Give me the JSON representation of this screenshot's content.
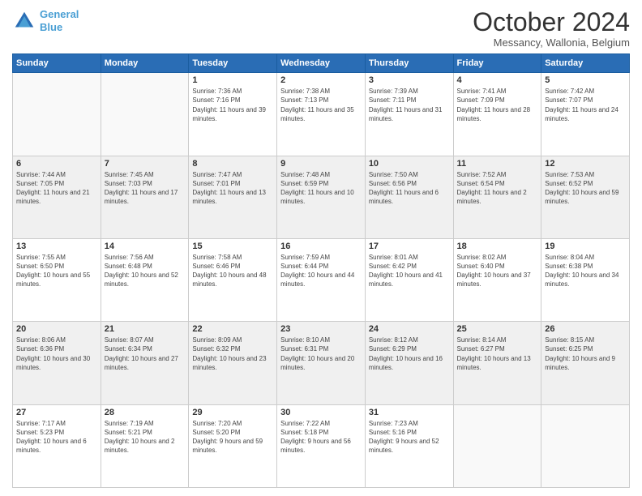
{
  "header": {
    "logo_line1": "General",
    "logo_line2": "Blue",
    "month": "October 2024",
    "location": "Messancy, Wallonia, Belgium"
  },
  "weekdays": [
    "Sunday",
    "Monday",
    "Tuesday",
    "Wednesday",
    "Thursday",
    "Friday",
    "Saturday"
  ],
  "weeks": [
    [
      {
        "day": "",
        "sunrise": "",
        "sunset": "",
        "daylight": ""
      },
      {
        "day": "",
        "sunrise": "",
        "sunset": "",
        "daylight": ""
      },
      {
        "day": "1",
        "sunrise": "Sunrise: 7:36 AM",
        "sunset": "Sunset: 7:16 PM",
        "daylight": "Daylight: 11 hours and 39 minutes."
      },
      {
        "day": "2",
        "sunrise": "Sunrise: 7:38 AM",
        "sunset": "Sunset: 7:13 PM",
        "daylight": "Daylight: 11 hours and 35 minutes."
      },
      {
        "day": "3",
        "sunrise": "Sunrise: 7:39 AM",
        "sunset": "Sunset: 7:11 PM",
        "daylight": "Daylight: 11 hours and 31 minutes."
      },
      {
        "day": "4",
        "sunrise": "Sunrise: 7:41 AM",
        "sunset": "Sunset: 7:09 PM",
        "daylight": "Daylight: 11 hours and 28 minutes."
      },
      {
        "day": "5",
        "sunrise": "Sunrise: 7:42 AM",
        "sunset": "Sunset: 7:07 PM",
        "daylight": "Daylight: 11 hours and 24 minutes."
      }
    ],
    [
      {
        "day": "6",
        "sunrise": "Sunrise: 7:44 AM",
        "sunset": "Sunset: 7:05 PM",
        "daylight": "Daylight: 11 hours and 21 minutes."
      },
      {
        "day": "7",
        "sunrise": "Sunrise: 7:45 AM",
        "sunset": "Sunset: 7:03 PM",
        "daylight": "Daylight: 11 hours and 17 minutes."
      },
      {
        "day": "8",
        "sunrise": "Sunrise: 7:47 AM",
        "sunset": "Sunset: 7:01 PM",
        "daylight": "Daylight: 11 hours and 13 minutes."
      },
      {
        "day": "9",
        "sunrise": "Sunrise: 7:48 AM",
        "sunset": "Sunset: 6:59 PM",
        "daylight": "Daylight: 11 hours and 10 minutes."
      },
      {
        "day": "10",
        "sunrise": "Sunrise: 7:50 AM",
        "sunset": "Sunset: 6:56 PM",
        "daylight": "Daylight: 11 hours and 6 minutes."
      },
      {
        "day": "11",
        "sunrise": "Sunrise: 7:52 AM",
        "sunset": "Sunset: 6:54 PM",
        "daylight": "Daylight: 11 hours and 2 minutes."
      },
      {
        "day": "12",
        "sunrise": "Sunrise: 7:53 AM",
        "sunset": "Sunset: 6:52 PM",
        "daylight": "Daylight: 10 hours and 59 minutes."
      }
    ],
    [
      {
        "day": "13",
        "sunrise": "Sunrise: 7:55 AM",
        "sunset": "Sunset: 6:50 PM",
        "daylight": "Daylight: 10 hours and 55 minutes."
      },
      {
        "day": "14",
        "sunrise": "Sunrise: 7:56 AM",
        "sunset": "Sunset: 6:48 PM",
        "daylight": "Daylight: 10 hours and 52 minutes."
      },
      {
        "day": "15",
        "sunrise": "Sunrise: 7:58 AM",
        "sunset": "Sunset: 6:46 PM",
        "daylight": "Daylight: 10 hours and 48 minutes."
      },
      {
        "day": "16",
        "sunrise": "Sunrise: 7:59 AM",
        "sunset": "Sunset: 6:44 PM",
        "daylight": "Daylight: 10 hours and 44 minutes."
      },
      {
        "day": "17",
        "sunrise": "Sunrise: 8:01 AM",
        "sunset": "Sunset: 6:42 PM",
        "daylight": "Daylight: 10 hours and 41 minutes."
      },
      {
        "day": "18",
        "sunrise": "Sunrise: 8:02 AM",
        "sunset": "Sunset: 6:40 PM",
        "daylight": "Daylight: 10 hours and 37 minutes."
      },
      {
        "day": "19",
        "sunrise": "Sunrise: 8:04 AM",
        "sunset": "Sunset: 6:38 PM",
        "daylight": "Daylight: 10 hours and 34 minutes."
      }
    ],
    [
      {
        "day": "20",
        "sunrise": "Sunrise: 8:06 AM",
        "sunset": "Sunset: 6:36 PM",
        "daylight": "Daylight: 10 hours and 30 minutes."
      },
      {
        "day": "21",
        "sunrise": "Sunrise: 8:07 AM",
        "sunset": "Sunset: 6:34 PM",
        "daylight": "Daylight: 10 hours and 27 minutes."
      },
      {
        "day": "22",
        "sunrise": "Sunrise: 8:09 AM",
        "sunset": "Sunset: 6:32 PM",
        "daylight": "Daylight: 10 hours and 23 minutes."
      },
      {
        "day": "23",
        "sunrise": "Sunrise: 8:10 AM",
        "sunset": "Sunset: 6:31 PM",
        "daylight": "Daylight: 10 hours and 20 minutes."
      },
      {
        "day": "24",
        "sunrise": "Sunrise: 8:12 AM",
        "sunset": "Sunset: 6:29 PM",
        "daylight": "Daylight: 10 hours and 16 minutes."
      },
      {
        "day": "25",
        "sunrise": "Sunrise: 8:14 AM",
        "sunset": "Sunset: 6:27 PM",
        "daylight": "Daylight: 10 hours and 13 minutes."
      },
      {
        "day": "26",
        "sunrise": "Sunrise: 8:15 AM",
        "sunset": "Sunset: 6:25 PM",
        "daylight": "Daylight: 10 hours and 9 minutes."
      }
    ],
    [
      {
        "day": "27",
        "sunrise": "Sunrise: 7:17 AM",
        "sunset": "Sunset: 5:23 PM",
        "daylight": "Daylight: 10 hours and 6 minutes."
      },
      {
        "day": "28",
        "sunrise": "Sunrise: 7:19 AM",
        "sunset": "Sunset: 5:21 PM",
        "daylight": "Daylight: 10 hours and 2 minutes."
      },
      {
        "day": "29",
        "sunrise": "Sunrise: 7:20 AM",
        "sunset": "Sunset: 5:20 PM",
        "daylight": "Daylight: 9 hours and 59 minutes."
      },
      {
        "day": "30",
        "sunrise": "Sunrise: 7:22 AM",
        "sunset": "Sunset: 5:18 PM",
        "daylight": "Daylight: 9 hours and 56 minutes."
      },
      {
        "day": "31",
        "sunrise": "Sunrise: 7:23 AM",
        "sunset": "Sunset: 5:16 PM",
        "daylight": "Daylight: 9 hours and 52 minutes."
      },
      {
        "day": "",
        "sunrise": "",
        "sunset": "",
        "daylight": ""
      },
      {
        "day": "",
        "sunrise": "",
        "sunset": "",
        "daylight": ""
      }
    ]
  ]
}
